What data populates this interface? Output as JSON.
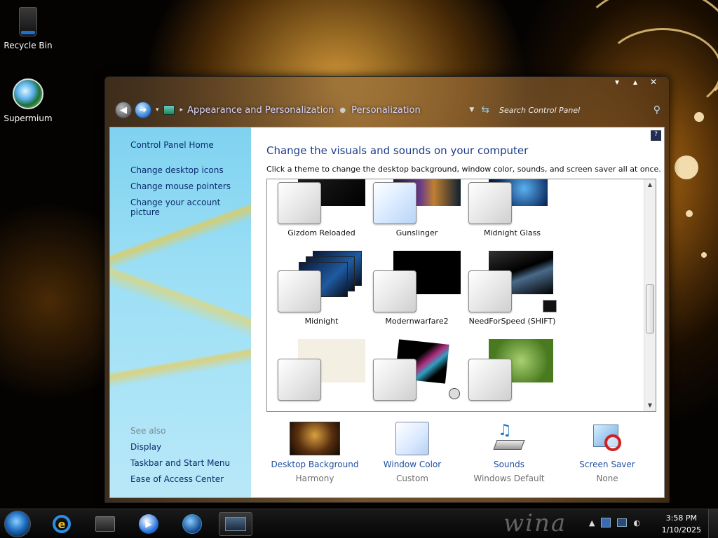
{
  "desktop": {
    "icons": [
      {
        "label": "Recycle Bin"
      },
      {
        "label": "Supermium"
      }
    ]
  },
  "window": {
    "controls": {
      "minimize": "▾",
      "maximize": "▴",
      "close": "✕"
    },
    "breadcrumb": [
      "Appearance and Personalization",
      "Personalization"
    ],
    "search_placeholder": "Search Control Panel",
    "help": "?"
  },
  "sidebar": {
    "home": "Control Panel Home",
    "links": [
      "Change desktop icons",
      "Change mouse pointers",
      "Change your account picture"
    ],
    "see_also_heading": "See also",
    "see_also": [
      "Display",
      "Taskbar and Start Menu",
      "Ease of Access Center"
    ]
  },
  "main": {
    "title": "Change the visuals and sounds on your computer",
    "subtitle": "Click a theme to change the desktop background, window color, sounds, and screen saver all at once.",
    "themes": [
      {
        "name": "Gizdom Reloaded"
      },
      {
        "name": "Gunslinger"
      },
      {
        "name": "Midnight Glass"
      },
      {
        "name": "Midnight"
      },
      {
        "name": "Modernwarfare2"
      },
      {
        "name": "NeedForSpeed (SHIFT)"
      }
    ],
    "bottom": [
      {
        "label": "Desktop Background",
        "sub": "Harmony"
      },
      {
        "label": "Window Color",
        "sub": "Custom"
      },
      {
        "label": "Sounds",
        "sub": "Windows Default"
      },
      {
        "label": "Screen Saver",
        "sub": "None"
      }
    ]
  },
  "taskbar": {
    "brand_watermark": "wina",
    "time": "3:58 PM",
    "date": "1/10/2025"
  },
  "colors": {
    "link": "#1e50a0",
    "title": "#1e3e8a",
    "sidebar": "#9cdff5"
  }
}
